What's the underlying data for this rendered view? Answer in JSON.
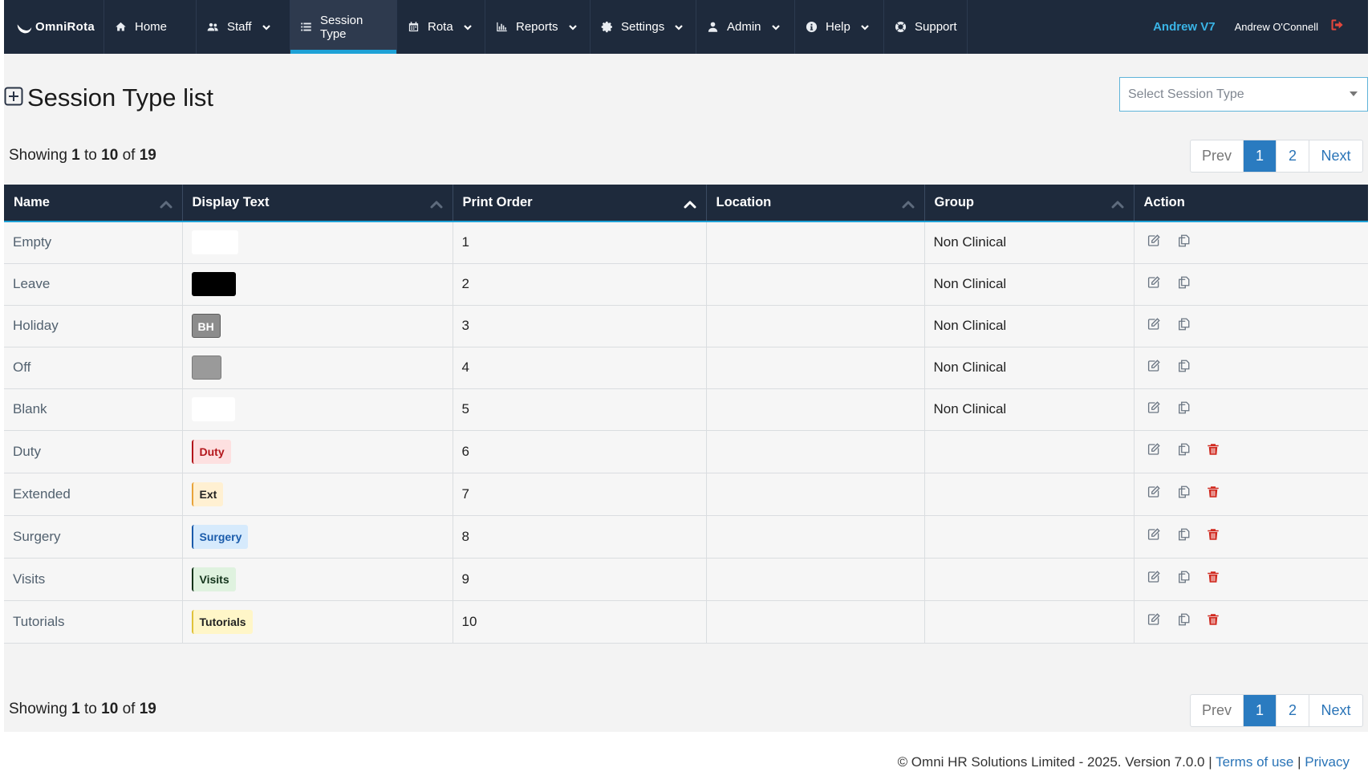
{
  "app": {
    "brand": "OmniRota",
    "version_badge": "Andrew V7",
    "user_name": "Andrew O'Connell"
  },
  "nav": {
    "items": [
      {
        "label": "Home",
        "icon": "home-icon",
        "dropdown": false,
        "active": false
      },
      {
        "label": "Staff",
        "icon": "users-icon",
        "dropdown": true,
        "active": false
      },
      {
        "label": "Session Type",
        "icon": "list-icon",
        "dropdown": false,
        "active": true
      },
      {
        "label": "Rota",
        "icon": "calendar-icon",
        "dropdown": true,
        "active": false
      },
      {
        "label": "Reports",
        "icon": "bar-chart-icon",
        "dropdown": true,
        "active": false
      },
      {
        "label": "Settings",
        "icon": "gear-icon",
        "dropdown": true,
        "active": false
      },
      {
        "label": "Admin",
        "icon": "user-icon",
        "dropdown": true,
        "active": false
      },
      {
        "label": "Help",
        "icon": "info-icon",
        "dropdown": true,
        "active": false
      },
      {
        "label": "Support",
        "icon": "lifebuoy-icon",
        "dropdown": false,
        "active": false
      }
    ]
  },
  "page": {
    "title": "Session Type list",
    "select_placeholder": "Select Session Type"
  },
  "pagination": {
    "showing_prefix": "Showing",
    "from": "1",
    "to_word": "to",
    "to": "10",
    "of_word": "of",
    "total": "19",
    "prev": "Prev",
    "pages": [
      "1",
      "2"
    ],
    "current": "1",
    "next": "Next"
  },
  "table": {
    "headers": [
      "Name",
      "Display Text",
      "Print Order",
      "Location",
      "Group",
      "Action"
    ],
    "rows": [
      {
        "name": "Empty",
        "display": {
          "text": "",
          "bg": "#ffffff",
          "fg": "#ffffff",
          "border": "#ffffff"
        },
        "order": "1",
        "location": "",
        "group": "Non Clinical",
        "deletable": false
      },
      {
        "name": "Leave",
        "display": {
          "text": "",
          "bg": "#000000",
          "fg": "#ffffff",
          "border": "#000000"
        },
        "order": "2",
        "location": "",
        "group": "Non Clinical",
        "deletable": false
      },
      {
        "name": "Holiday",
        "display": {
          "text": "BH",
          "bg": "#8c8c8c",
          "fg": "#ffffff",
          "border": "#5c5c5c"
        },
        "order": "3",
        "location": "",
        "group": "Non Clinical",
        "deletable": false
      },
      {
        "name": "Off",
        "display": {
          "text": "",
          "bg": "#9a9a9a",
          "fg": "#ffffff",
          "border": "#7a7a7a"
        },
        "order": "4",
        "location": "",
        "group": "Non Clinical",
        "deletable": false
      },
      {
        "name": "Blank",
        "display": {
          "text": "",
          "bg": "#ffffff",
          "fg": "#ffffff",
          "border": "#ffffff"
        },
        "order": "5",
        "location": "",
        "group": "Non Clinical",
        "deletable": false
      },
      {
        "name": "Duty",
        "display": {
          "text": "Duty",
          "bg": "#fde0e0",
          "fg": "#b3161b",
          "border": "#b3161b"
        },
        "order": "6",
        "location": "",
        "group": "",
        "deletable": true
      },
      {
        "name": "Extended",
        "display": {
          "text": "Ext",
          "bg": "#fff0d2",
          "fg": "#222222",
          "border": "#e8a33a"
        },
        "order": "7",
        "location": "",
        "group": "",
        "deletable": true
      },
      {
        "name": "Surgery",
        "display": {
          "text": "Surgery",
          "bg": "#d6eafc",
          "fg": "#1b5cab",
          "border": "#1b5cab"
        },
        "order": "8",
        "location": "",
        "group": "",
        "deletable": true
      },
      {
        "name": "Visits",
        "display": {
          "text": "Visits",
          "bg": "#dff2df",
          "fg": "#12331a",
          "border": "#12331a"
        },
        "order": "9",
        "location": "",
        "group": "",
        "deletable": true
      },
      {
        "name": "Tutorials",
        "display": {
          "text": "Tutorials",
          "bg": "#fff6c8",
          "fg": "#222222",
          "border": "#e0c23a"
        },
        "order": "10",
        "location": "",
        "group": "",
        "deletable": true
      }
    ]
  },
  "footer": {
    "copyright": "© Omni HR Solutions Limited - 2025. Version 7.0.0 |",
    "terms": "Terms of use",
    "sep": "|",
    "privacy": "Privacy"
  },
  "colors": {
    "navbar": "#1e2a3c",
    "accent": "#1ea1d6",
    "pager_active": "#2a7bc0",
    "delete": "#d0281e"
  }
}
